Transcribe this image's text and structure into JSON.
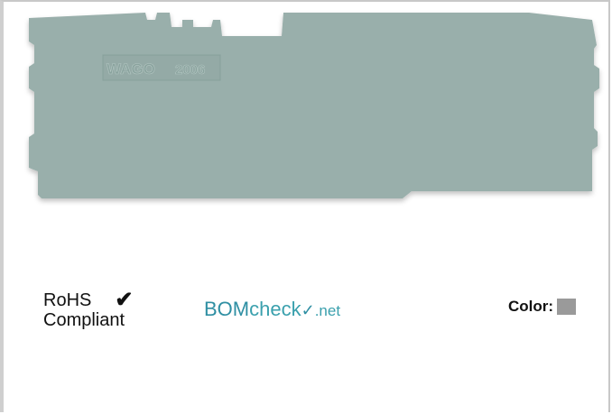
{
  "product": {
    "image_name": "end-plate-product-photo",
    "body_color": "#99afab",
    "embossed_brand": "WAGO",
    "embossed_number": "2006"
  },
  "rohs": {
    "line1": "RoHS",
    "line2": "Compliant",
    "check": "✔"
  },
  "bomcheck": {
    "part1": "BOM",
    "part2": "check",
    "tick": "✓",
    "part3": ".net"
  },
  "color": {
    "label": "Color:",
    "swatch_hex": "#9a9a9a"
  }
}
